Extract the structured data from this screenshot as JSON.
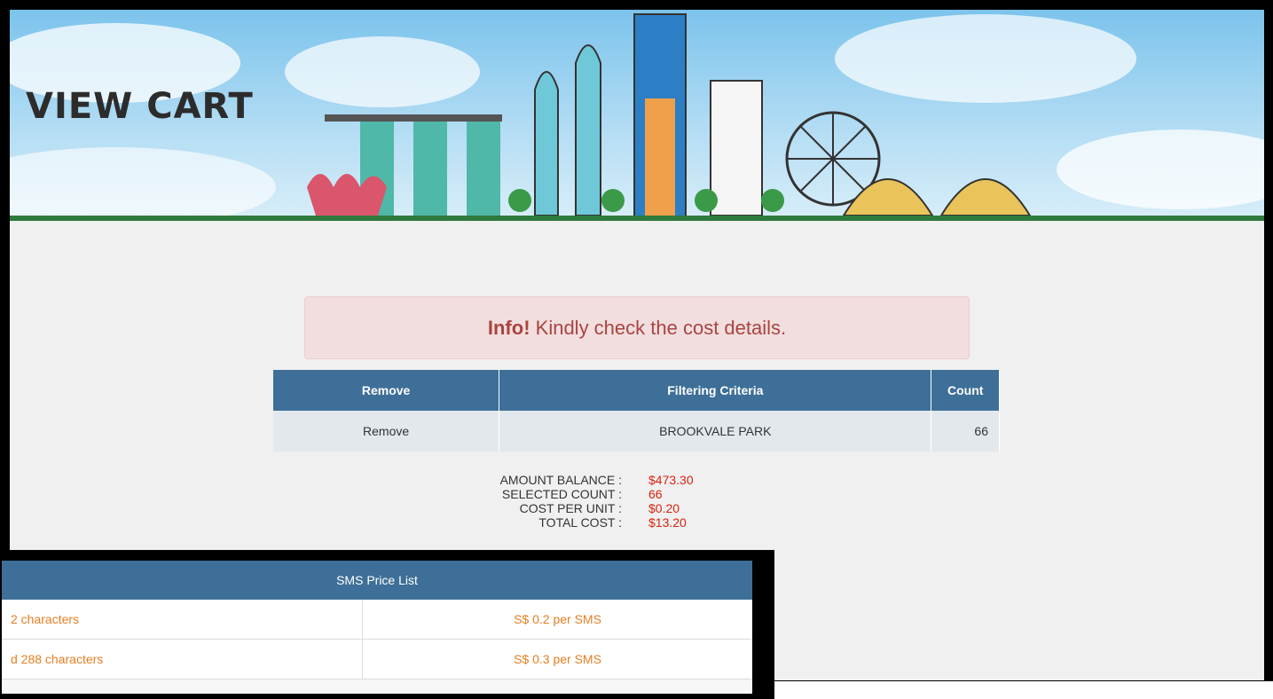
{
  "banner": {
    "title": "VIEW CART"
  },
  "alert": {
    "strong": "Info!",
    "message": " Kindly check the cost details."
  },
  "cart_table": {
    "headers": [
      "Remove",
      "Filtering Criteria",
      "Count"
    ],
    "rows": [
      {
        "remove": "Remove",
        "criteria": "BROOKVALE PARK",
        "count": "66"
      }
    ]
  },
  "summary": {
    "amount_balance_label": "AMOUNT BALANCE :",
    "amount_balance_value": "$473.30",
    "selected_count_label": "SELECTED COUNT :",
    "selected_count_value": "66",
    "cost_per_unit_label": "COST PER UNIT :",
    "cost_per_unit_value": "$0.20",
    "total_cost_label": "TOTAL COST :",
    "total_cost_value": "$13.20"
  },
  "price_list": {
    "title": "SMS Price List",
    "rows": [
      {
        "desc": "2 characters",
        "price": "S$ 0.2 per SMS"
      },
      {
        "desc": "d 288 characters",
        "price": "S$ 0.3 per SMS"
      }
    ]
  },
  "colors": {
    "header_blue": "#3e6f98",
    "alert_bg": "#f2dede",
    "accent_red": "#d9230f",
    "orange": "#e67e22"
  }
}
